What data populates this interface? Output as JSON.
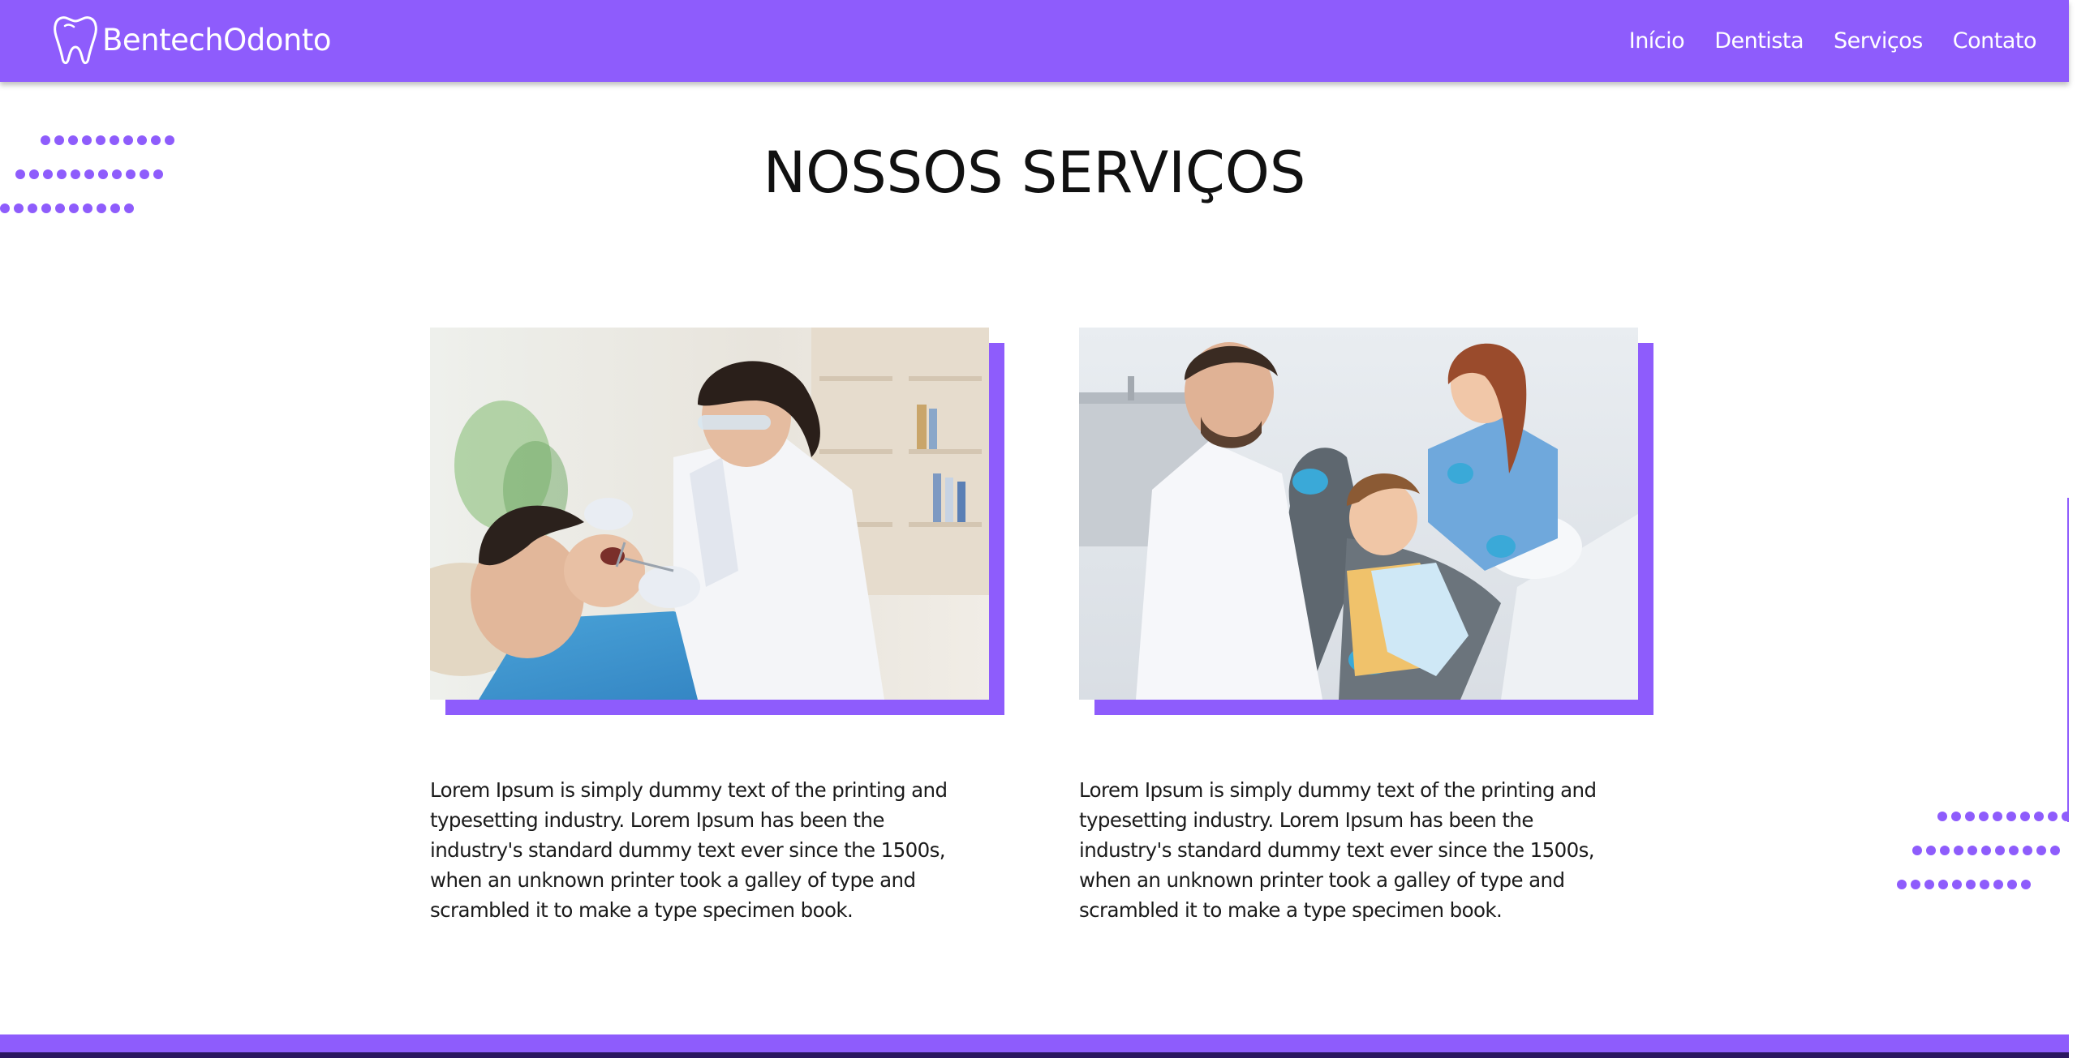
{
  "header": {
    "brand": "BentechOdonto",
    "brand_icon": "tooth-icon",
    "nav": [
      {
        "label": "Início"
      },
      {
        "label": "Dentista"
      },
      {
        "label": "Serviços"
      },
      {
        "label": "Contato"
      }
    ]
  },
  "services": {
    "title": "NOSSOS SERVIÇOS",
    "cards": [
      {
        "image": "dentist-examining-patient-photo",
        "text": "Lorem Ipsum is simply dummy text of the printing and typesetting industry. Lorem Ipsum has been the industry's standard dummy text ever since the 1500s, when an unknown printer took a galley of type and scrambled it to make a type specimen book."
      },
      {
        "image": "dentists-with-child-patient-photo",
        "text": "Lorem Ipsum is simply dummy text of the printing and typesetting industry. Lorem Ipsum has been the industry's standard dummy text ever since the 1500s, when an unknown printer took a galley of type and scrambled it to make a type specimen book."
      }
    ]
  },
  "colors": {
    "accent": "#8e5cfc",
    "background": "#ffffff",
    "text": "#111111"
  }
}
